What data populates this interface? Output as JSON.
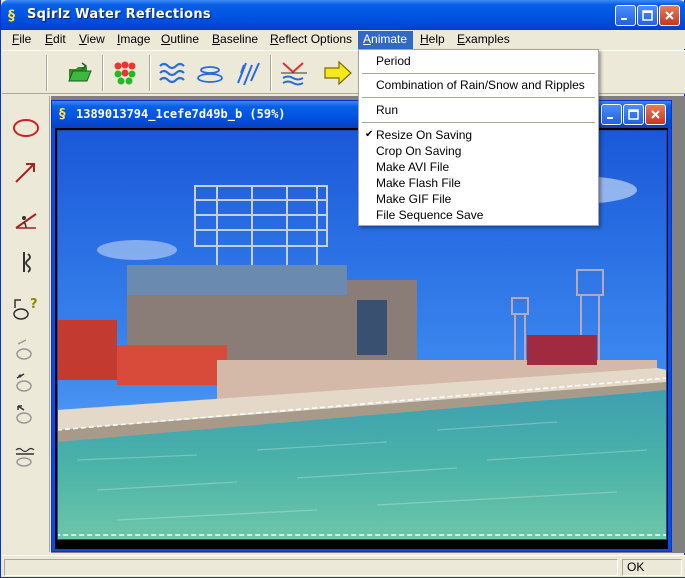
{
  "window": {
    "title": "Sqirlz Water Reflections"
  },
  "menubar": {
    "items": [
      {
        "label": "File",
        "accel": "F",
        "rest": "ile"
      },
      {
        "label": "Edit",
        "accel": "E",
        "rest": "dit"
      },
      {
        "label": "View",
        "accel": "V",
        "rest": "iew"
      },
      {
        "label": "Image",
        "accel": "I",
        "rest": "mage"
      },
      {
        "label": "Outline",
        "accel": "O",
        "rest": "utline"
      },
      {
        "label": "Baseline",
        "accel": "B",
        "rest": "aseline"
      },
      {
        "label": "Reflect Options",
        "accel": "R",
        "rest": "eflect Options"
      },
      {
        "label": "Animate",
        "accel": "A",
        "rest": "nimate"
      },
      {
        "label": "Help",
        "accel": "H",
        "rest": "elp"
      },
      {
        "label": "Examples",
        "accel": "E",
        "rest": "xamples"
      }
    ],
    "active": "Animate"
  },
  "animate_menu": {
    "period": "Period",
    "combination": "Combination of Rain/Snow and Ripples",
    "run": "Run",
    "resize_on_saving": "Resize On Saving",
    "resize_checked": true,
    "crop_on_saving": "Crop On Saving",
    "make_avi": "Make AVI File",
    "make_flash": "Make Flash File",
    "make_gif": "Make GIF File",
    "file_sequence": "File Sequence Save"
  },
  "child_window": {
    "title": "1389013794_1cefe7d49b_b  (59%)"
  },
  "statusbar": {
    "status": "OK"
  },
  "colors": {
    "titlebar": "#0055e5",
    "menu_highlight": "#316ac5",
    "face": "#ece9d8"
  }
}
